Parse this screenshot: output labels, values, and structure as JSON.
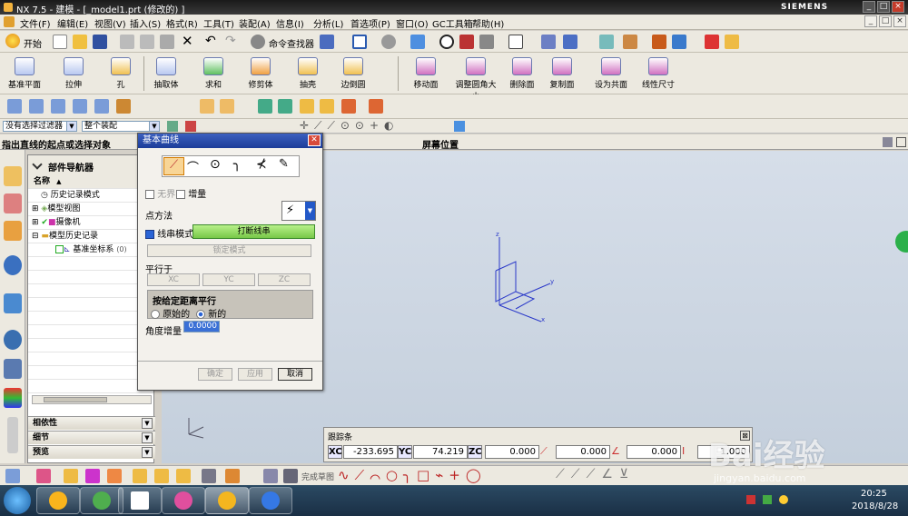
{
  "window": {
    "title": "NX 7.5 - 建模 - [_model1.prt (修改的) ]",
    "brand": "SIEMENS"
  },
  "menu": [
    "文件(F)",
    "编辑(E)",
    "视图(V)",
    "插入(S)",
    "格式(R)",
    "工具(T)",
    "装配(A)",
    "信息(I)",
    "分析(L)",
    "首选项(P)",
    "窗口(O)",
    "GC工具箱",
    "帮助(H)"
  ],
  "standard_bar": {
    "start_label": "开始",
    "command_finder_label": "命令查找器"
  },
  "feature_bar": [
    "基准平面",
    "拉伸",
    "孔",
    "抽取体",
    "求和",
    "修剪体",
    "抽壳",
    "边倒圆"
  ],
  "sync_bar": [
    "移动面",
    "调整圆角大小",
    "删除面",
    "复制面",
    "设为共面",
    "线性尺寸"
  ],
  "selection": {
    "filter": "没有选择过滤器",
    "scope": "整个装配"
  },
  "cue": {
    "message": "指出直线的起点或选择对象",
    "status": "屏幕位置"
  },
  "navigator": {
    "title": "部件导航器",
    "column": "名称",
    "items": [
      {
        "label": "历史记录模式",
        "level": 0
      },
      {
        "label": "模型视图",
        "level": 0
      },
      {
        "label": "摄像机",
        "level": 0
      },
      {
        "label": "模型历史记录",
        "level": 0
      },
      {
        "label": "基准坐标系",
        "suffix": "(0)",
        "level": 1
      }
    ]
  },
  "accordion": [
    "相依性",
    "细节",
    "预览"
  ],
  "dialog": {
    "title": "基本曲线",
    "unbounded_label": "无界",
    "incremental_label": "增量",
    "point_method_label": "点方法",
    "string_mode_label": "线串模式",
    "break_string_label": "打断线串",
    "lock_mode_label": "锁定模式",
    "parallel_to_label": "平行于",
    "xc_label": "XC",
    "yc_label": "YC",
    "zc_label": "ZC",
    "offset_group_label": "按给定距离平行",
    "original_label": "原始的",
    "new_label": "新的",
    "angle_increment_label": "角度增量",
    "angle_increment_value": "0.0000",
    "ok_label": "确定",
    "apply_label": "应用",
    "cancel_label": "取消"
  },
  "tracker": {
    "title": "跟踪条",
    "xc_label": "XC",
    "xc_value": "-233.695",
    "yc_label": "YC",
    "yc_value": "74.219",
    "zc_label": "ZC",
    "zc_value": "0.000",
    "length_value": "0.000",
    "angle_value": "0.000",
    "offset_value": "0.000",
    "last_value": "1.000"
  },
  "bottom_bar": {
    "finish_sketch_label": "完成草图"
  },
  "taskbar": {
    "time": "20:25",
    "date": "2018/8/28"
  },
  "watermark": {
    "brand": "Bai经验",
    "url": "jingyan.baidu.com"
  }
}
